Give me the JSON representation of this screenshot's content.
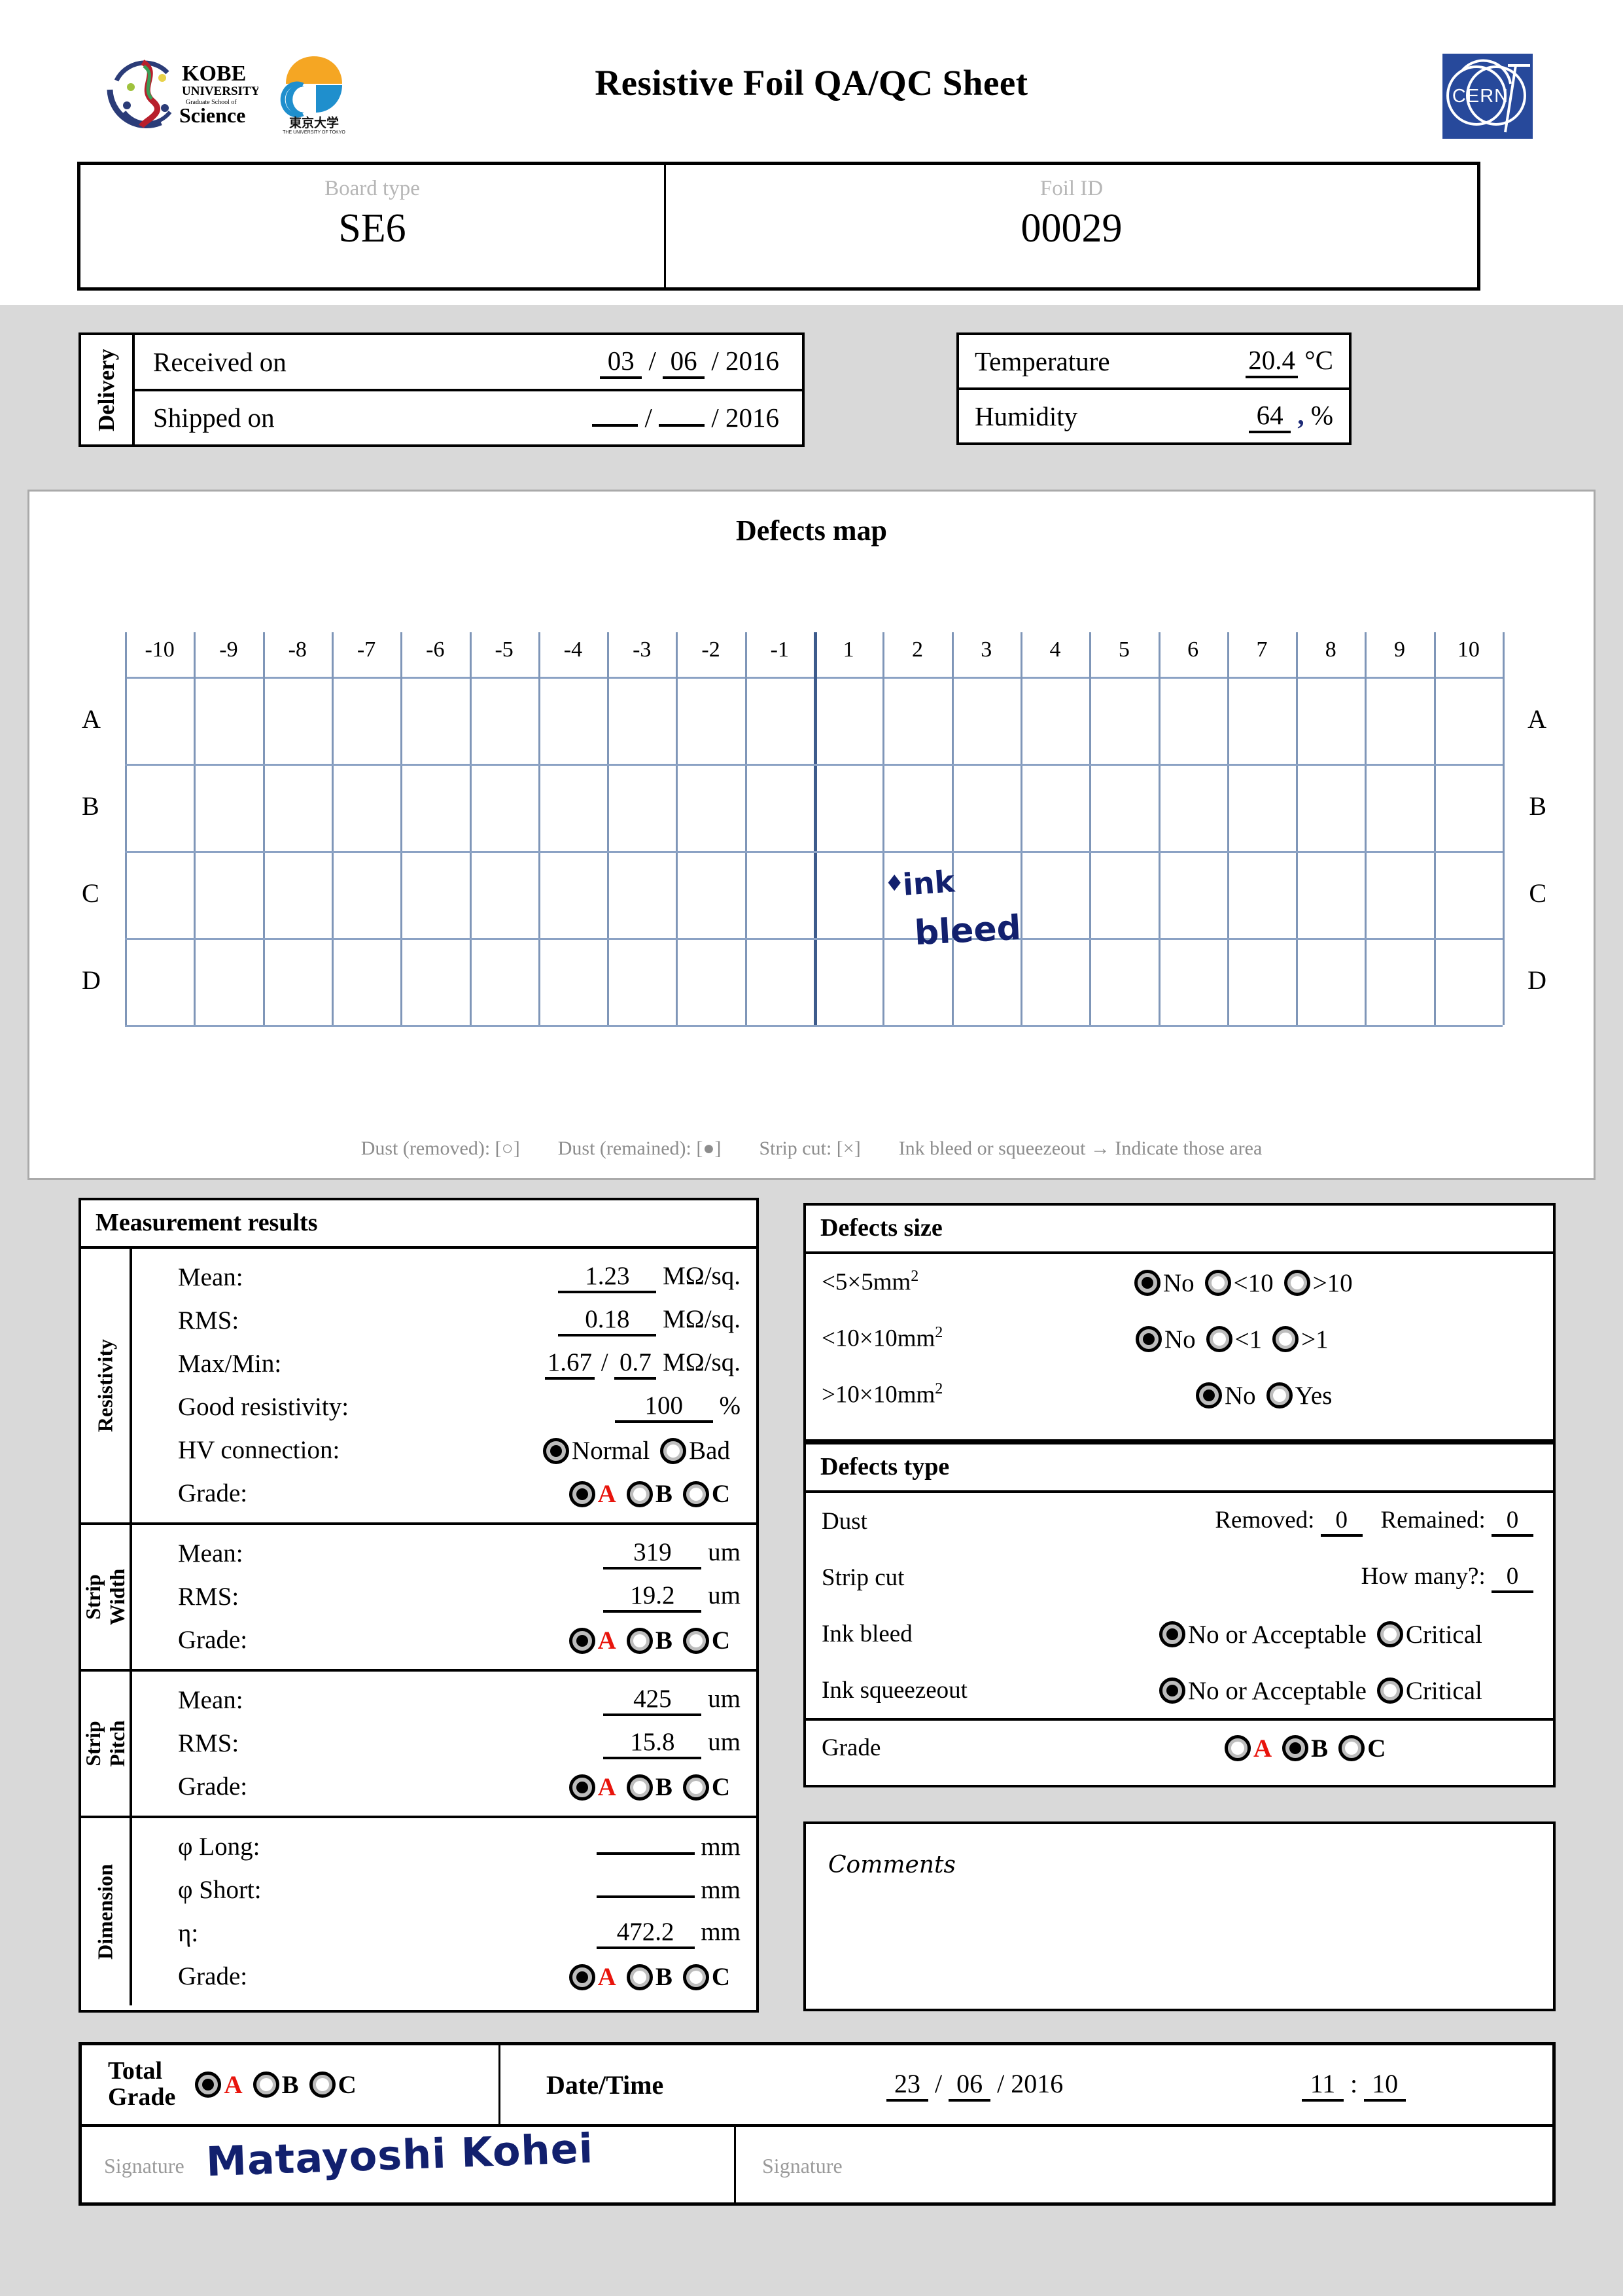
{
  "header": {
    "title": "Resistive Foil QA/QC Sheet",
    "logo_kobe": "kobe-university-logo",
    "logo_tokyo": "university-of-tokyo-logo",
    "logo_cern": "cern-logo",
    "cern_text": "CERN",
    "cern_color": "#27499b"
  },
  "identification": {
    "board_type_caption": "Board type",
    "board_type_value": "SE6",
    "foil_id_caption": "Foil ID",
    "foil_id_value": "00029"
  },
  "delivery": {
    "section_label": "Delivery",
    "received_label": "Received on",
    "received_day": "03",
    "received_month": "06",
    "received_year": "2016",
    "shipped_label": "Shipped on",
    "shipped_day": "",
    "shipped_month": "",
    "shipped_year": "2016"
  },
  "environment": {
    "temperature_label": "Temperature",
    "temperature_value": "20.4",
    "temperature_unit": "°C",
    "humidity_label": "Humidity",
    "humidity_value": "64",
    "humidity_ink": ",",
    "humidity_unit": "%"
  },
  "defects_map": {
    "title": "Defects map",
    "col_labels": [
      "-10",
      "-9",
      "-8",
      "-7",
      "-6",
      "-5",
      "-4",
      "-3",
      "-2",
      "-1",
      "1",
      "2",
      "3",
      "4",
      "5",
      "6",
      "7",
      "8",
      "9",
      "10"
    ],
    "row_labels": [
      "A",
      "B",
      "C",
      "D"
    ],
    "handwriting": {
      "tick": "✈",
      "line1": "ink",
      "line2": "bleed"
    },
    "legend": [
      "Dust (removed): [○]",
      "Dust (remained): [●]",
      "Strip cut: [×]",
      "Ink bleed or squeezeout → Indicate those area"
    ]
  },
  "measurement": {
    "title": "Measurement results",
    "groups": [
      {
        "side_label": "Resistivity",
        "rows": [
          {
            "label": "Mean:",
            "value": "1.23",
            "unit": "MΩ/sq."
          },
          {
            "label": "RMS:",
            "value": "0.18",
            "unit": "MΩ/sq."
          },
          {
            "label": "Max/Min:",
            "value": "1.67",
            "value2": "0.7",
            "unit": "MΩ/sq."
          },
          {
            "label": "Good resistivity:",
            "value": "100",
            "unit": "%"
          },
          {
            "label": "HV connection:",
            "options": [
              "Normal",
              "Bad"
            ],
            "selected": "Normal"
          },
          {
            "label": "Grade:",
            "options": [
              "A",
              "B",
              "C"
            ],
            "selected": "A"
          }
        ]
      },
      {
        "side_label": "Strip\nWidth",
        "rows": [
          {
            "label": "Mean:",
            "value": "319",
            "unit": "um"
          },
          {
            "label": "RMS:",
            "value": "19.2",
            "unit": "um"
          },
          {
            "label": "Grade:",
            "options": [
              "A",
              "B",
              "C"
            ],
            "selected": "A"
          }
        ]
      },
      {
        "side_label": "Strip\nPitch",
        "rows": [
          {
            "label": "Mean:",
            "value": "425",
            "unit": "um"
          },
          {
            "label": "RMS:",
            "value": "15.8",
            "unit": "um"
          },
          {
            "label": "Grade:",
            "options": [
              "A",
              "B",
              "C"
            ],
            "selected": "A"
          }
        ]
      },
      {
        "side_label": "Dimension",
        "rows": [
          {
            "label": "φ Long:",
            "value": "",
            "unit": "mm"
          },
          {
            "label": "φ Short:",
            "value": "",
            "unit": "mm"
          },
          {
            "label": "η:",
            "value": "472.2",
            "unit": "mm"
          },
          {
            "label": "Grade:",
            "options": [
              "A",
              "B",
              "C"
            ],
            "selected": "A"
          }
        ]
      }
    ]
  },
  "defects_size": {
    "title": "Defects size",
    "rows": [
      {
        "label": "<5×5mm",
        "sup": "2",
        "options": [
          "No",
          "<10",
          ">10"
        ],
        "selected": "No"
      },
      {
        "label": "<10×10mm",
        "sup": "2",
        "options": [
          "No",
          "<1",
          ">1"
        ],
        "selected": "No"
      },
      {
        "label": ">10×10mm",
        "sup": "2",
        "options": [
          "No",
          "Yes"
        ],
        "selected": "No"
      }
    ]
  },
  "defects_type": {
    "title": "Defects type",
    "dust_label": "Dust",
    "dust_removed_label": "Removed:",
    "dust_removed_value": "0",
    "dust_remained_label": "Remained:",
    "dust_remained_value": "0",
    "strip_cut_label": "Strip cut",
    "strip_cut_question": "How many?:",
    "strip_cut_value": "0",
    "ink_bleed_label": "Ink bleed",
    "ink_bleed_options": [
      "No or Acceptable",
      "Critical"
    ],
    "ink_bleed_selected": "No or Acceptable",
    "ink_squeezeout_label": "Ink squeezeout",
    "ink_squeezeout_options": [
      "No or Acceptable",
      "Critical"
    ],
    "ink_squeezeout_selected": "No or Acceptable",
    "grade_label": "Grade",
    "grade_options": [
      "A",
      "B",
      "C"
    ],
    "grade_selected": "B"
  },
  "comments": {
    "label": "Comments",
    "text": ""
  },
  "footer": {
    "total_grade_label_line1": "Total",
    "total_grade_label_line2": "Grade",
    "total_grade_options": [
      "A",
      "B",
      "C"
    ],
    "total_grade_selected": "A",
    "datetime_label": "Date/Time",
    "date_day": "23",
    "date_month": "06",
    "date_year": "2016",
    "time_hour": "11",
    "time_minute": "10",
    "signature_label_left": "Signature",
    "signature_value_left": "Matayoshi Kohei",
    "signature_label_right": "Signature",
    "signature_value_right": ""
  },
  "colors": {
    "grade_a_red": "#e8140c",
    "grid_blue": "#8ba2c4",
    "grid_center": "#3d5b8c",
    "ink_blue": "#12206e",
    "page_grey": "#d9d9d9"
  }
}
